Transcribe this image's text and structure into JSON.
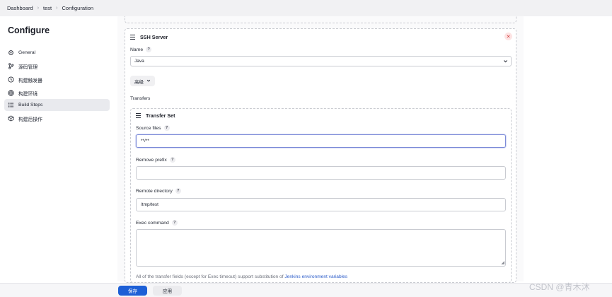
{
  "breadcrumb": [
    "Dashboard",
    "test",
    "Configuration"
  ],
  "sidebar": {
    "title": "Configure",
    "items": [
      {
        "label": "General",
        "icon": "gear-icon"
      },
      {
        "label": "源码管理",
        "icon": "branch-icon"
      },
      {
        "label": "构建触发器",
        "icon": "clock-icon"
      },
      {
        "label": "构建环境",
        "icon": "globe-icon"
      },
      {
        "label": "Build Steps",
        "icon": "list-icon",
        "active": true
      },
      {
        "label": "构建后操作",
        "icon": "cube-icon"
      }
    ]
  },
  "ssh_server": {
    "title": "SSH Server",
    "name_label": "Name",
    "name_value": "Java",
    "advanced_label": "高级",
    "transfers_label": "Transfers"
  },
  "transfer_set": {
    "title": "Transfer Set",
    "source_files_label": "Source files",
    "source_files_value": "**/**",
    "remove_prefix_label": "Remove prefix",
    "remove_prefix_value": "",
    "remote_directory_label": "Remote directory",
    "remote_directory_value": "/tmp/test",
    "exec_command_label": "Exec command",
    "exec_command_value": ""
  },
  "help_glyph": "?",
  "note": {
    "text": "All of the transfer fields (except for Exec timeout) support substitution of ",
    "link": "Jenkins environment variables"
  },
  "footer": {
    "save_label": "保存",
    "apply_label": "应用"
  },
  "watermark": "CSDN @青木沐",
  "colors": {
    "primary": "#1d5fd6",
    "link": "#2a5bc9",
    "danger": "#d23a3a",
    "active_bg": "#e9eaee"
  }
}
